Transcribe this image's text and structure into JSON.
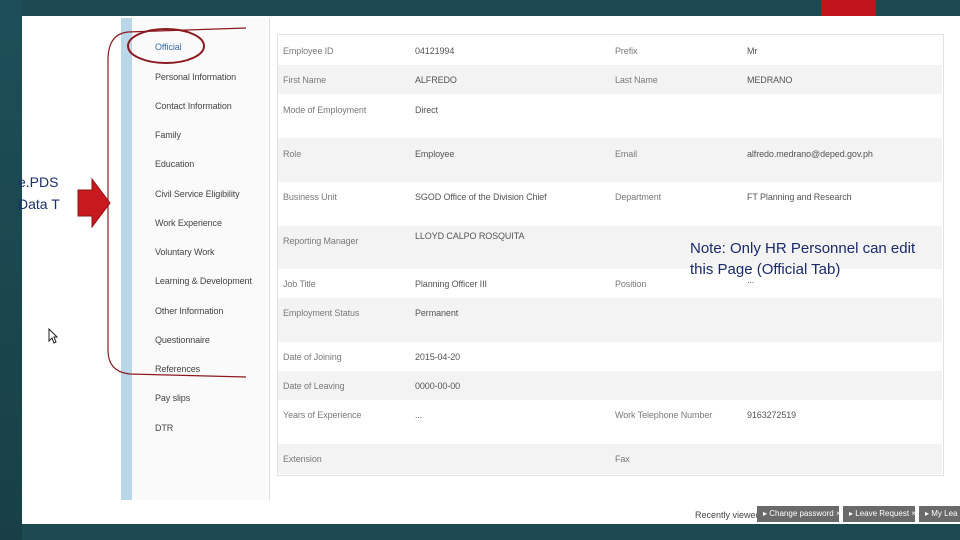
{
  "sidebar": {
    "items": [
      {
        "label": "Official"
      },
      {
        "label": "Personal Information"
      },
      {
        "label": "Contact Information"
      },
      {
        "label": "Family"
      },
      {
        "label": "Education"
      },
      {
        "label": "Civil Service Eligibility"
      },
      {
        "label": "Work Experience"
      },
      {
        "label": "Voluntary Work"
      },
      {
        "label": "Learning & Development"
      },
      {
        "label": "Other Information"
      },
      {
        "label": "Questionnaire"
      },
      {
        "label": "References"
      },
      {
        "label": "Pay slips"
      },
      {
        "label": "DTR"
      }
    ]
  },
  "fields": {
    "employee_id": {
      "label": "Employee ID",
      "value": "04121994"
    },
    "prefix": {
      "label": "Prefix",
      "value": "Mr"
    },
    "first_name": {
      "label": "First Name",
      "value": "ALFREDO"
    },
    "last_name": {
      "label": "Last Name",
      "value": "MEDRANO"
    },
    "mode_of_employment": {
      "label": "Mode of Employment",
      "value": "Direct"
    },
    "role": {
      "label": "Role",
      "value": "Employee"
    },
    "email": {
      "label": "Email",
      "value": "alfredo.medrano@deped.gov.ph"
    },
    "business_unit": {
      "label": "Business Unit",
      "value": "SGOD Office of the Division Chief"
    },
    "department": {
      "label": "Department",
      "value": "FT Planning and Research"
    },
    "reporting_manager": {
      "label": "Reporting Manager",
      "value": "LLOYD CALPO ROSQUITA"
    },
    "job_title": {
      "label": "Job Title",
      "value": "Planning Officer III"
    },
    "position": {
      "label": "Position",
      "value": "..."
    },
    "employment_status": {
      "label": "Employment Status",
      "value": "Permanent"
    },
    "date_of_joining": {
      "label": "Date of Joining",
      "value": "2015-04-20"
    },
    "date_of_leaving": {
      "label": "Date of Leaving",
      "value": "0000-00-00"
    },
    "years_of_experience": {
      "label": "Years of Experience",
      "value": "..."
    },
    "work_telephone": {
      "label": "Work Telephone Number",
      "value": "9163272519"
    },
    "extension": {
      "label": "Extension",
      "value": ""
    },
    "fax": {
      "label": "Fax",
      "value": ""
    }
  },
  "overlay": {
    "left_text_line1": "e.PDS",
    "left_text_line2": "Data T",
    "note": "Note: Only HR Personnel can edit this Page (Official Tab)"
  },
  "footer": {
    "recently_viewed": "Recently viewed",
    "buttons": [
      {
        "label": "▸ Change password ×"
      },
      {
        "label": "▸ Leave Request ×"
      },
      {
        "label": "▸ My Lea"
      }
    ]
  },
  "colors": {
    "arrow": "#c8191e",
    "annotation_line": "#8b1a20",
    "sidebar_stripe": "#b9d7e8",
    "active_link": "#3a6ea8"
  }
}
